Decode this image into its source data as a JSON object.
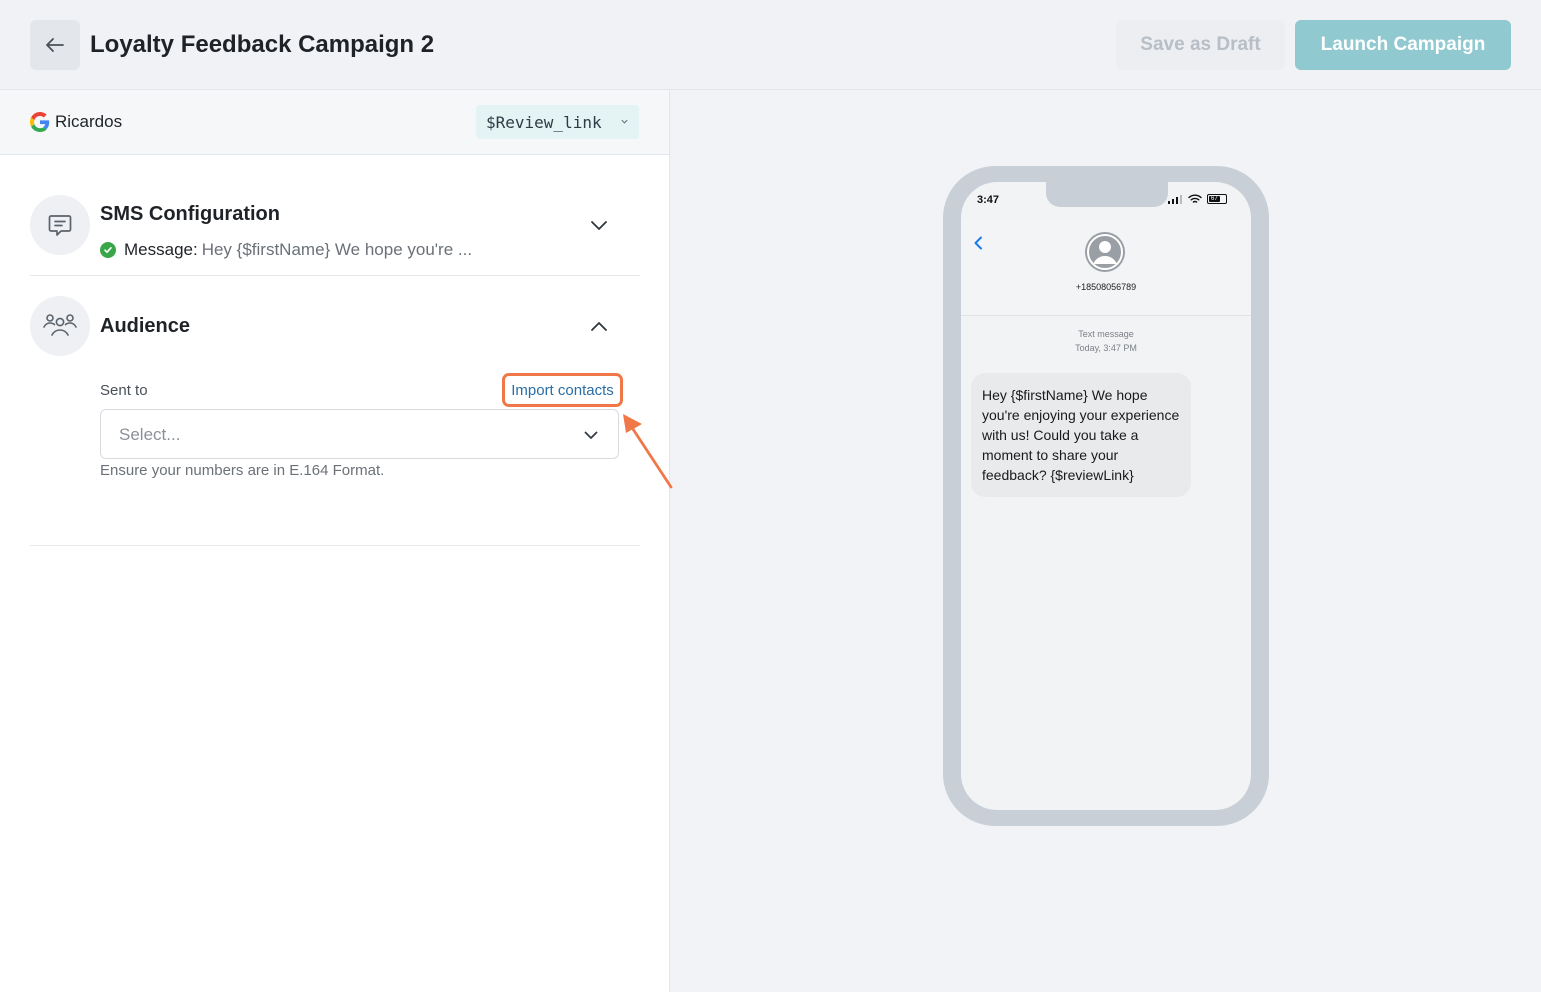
{
  "header": {
    "title": "Loyalty Feedback Campaign 2",
    "save_draft_label": "Save as Draft",
    "launch_label": "Launch Campaign"
  },
  "business": {
    "name": "Ricardos",
    "review_tag": "$Review_link"
  },
  "sms_section": {
    "title": "SMS Configuration",
    "message_label": "Message:",
    "message_preview": "Hey {$firstName} We hope you're ..."
  },
  "audience_section": {
    "title": "Audience",
    "sent_to_label": "Sent to",
    "import_link": "Import contacts",
    "select_placeholder": "Select...",
    "hint": "Ensure your numbers are in E.164 Format."
  },
  "phone_preview": {
    "time": "3:47",
    "battery": "67",
    "contact_number": "+18508056789",
    "meta_label": "Text message",
    "meta_time": "Today, 3:47 PM",
    "message": "Hey {$firstName} We hope you're enjoying your experience with us! Could you take a moment to share your feedback? {$reviewLink}"
  },
  "colors": {
    "launch_button": "#90c9cf",
    "highlight": "#f07848",
    "link": "#2a6ea6",
    "success": "#3aa64a"
  }
}
